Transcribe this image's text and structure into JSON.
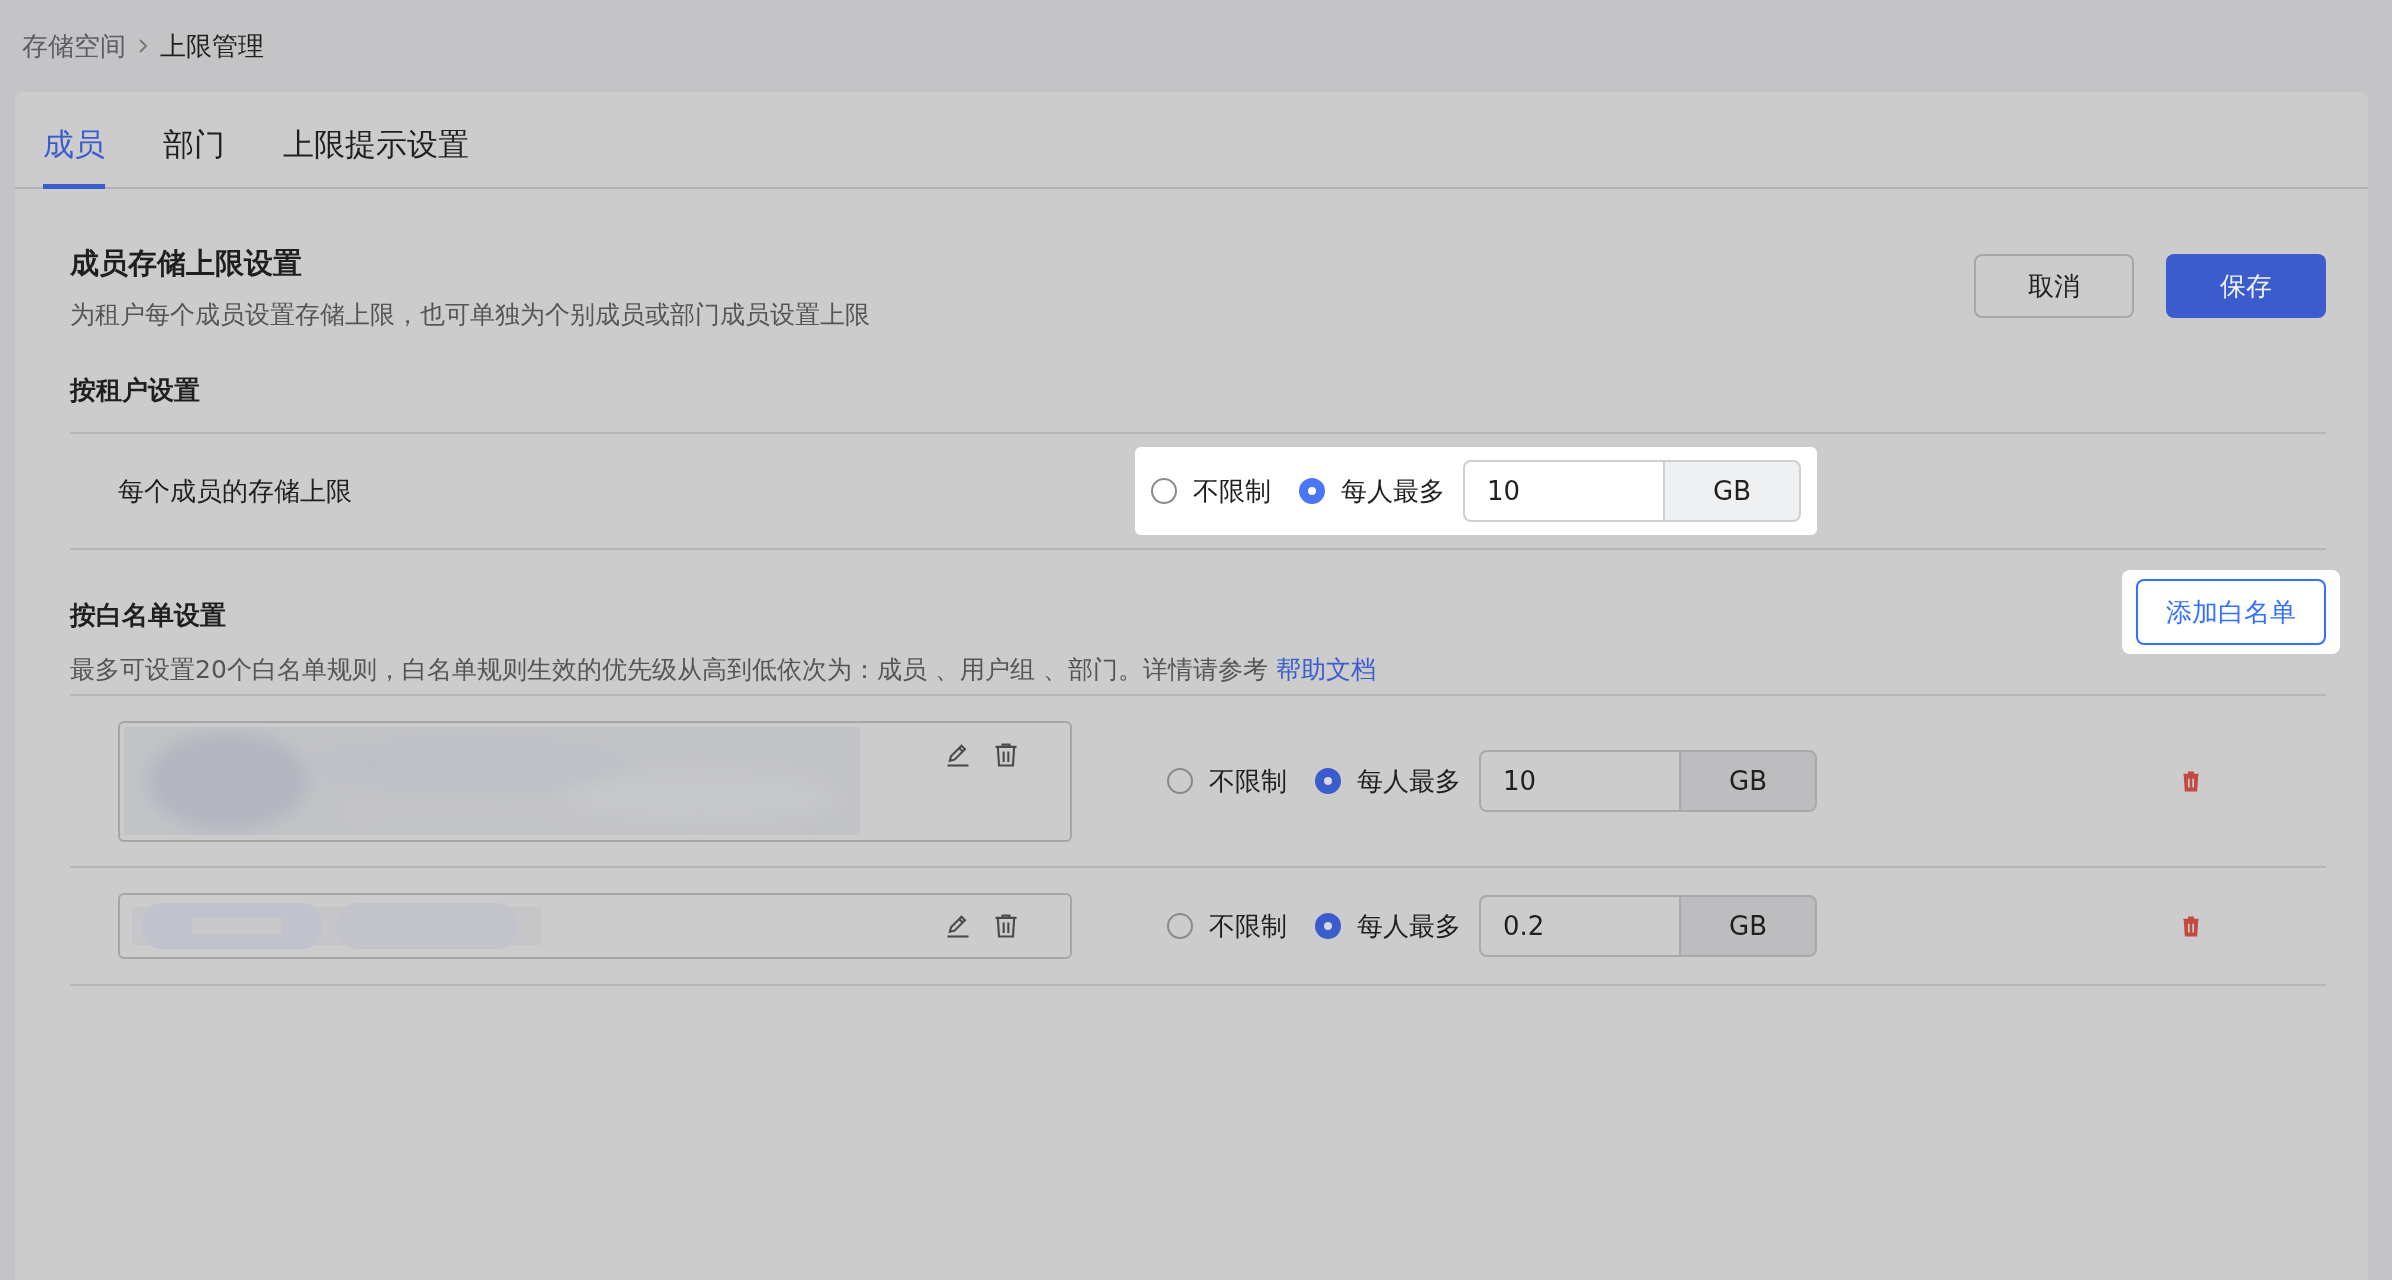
{
  "breadcrumb": [
    {
      "label": "存储空间"
    },
    {
      "label": "上限管理"
    }
  ],
  "tabs": [
    {
      "label": "成员",
      "selected": true
    },
    {
      "label": "部门",
      "selected": false
    },
    {
      "label": "上限提示设置",
      "selected": false
    }
  ],
  "header": {
    "title": "成员存储上限设置",
    "subtitle": "为租户每个成员设置存储上限，也可单独为个别成员或部门成员设置上限"
  },
  "buttons": [
    {
      "label": "取消",
      "kind": "secondary"
    },
    {
      "label": "保存",
      "kind": "primary"
    }
  ],
  "tenant_section": {
    "title": "按租户设置",
    "row": {
      "label": "每个成员的存储上限",
      "highlighted": true,
      "options": [
        {
          "label": "不限制",
          "selected": false
        },
        {
          "label": "每人最多",
          "selected": true
        }
      ],
      "value": "10",
      "unit": "GB"
    }
  },
  "whitelist_section": {
    "title": "按白名单设置",
    "description": "最多可设置20个白名单规则，白名单规则生效的优先级从高到低依次为：成员 、用户组 、部门。详情请参考",
    "help_link": "帮助文档",
    "add_button": {
      "label": "添加白名单",
      "highlighted": true
    },
    "rules": [
      {
        "kind": "block",
        "options": [
          {
            "label": "不限制",
            "selected": false
          },
          {
            "label": "每人最多",
            "selected": true
          }
        ],
        "value": "10",
        "unit": "GB"
      },
      {
        "kind": "chips",
        "options": [
          {
            "label": "不限制",
            "selected": false
          },
          {
            "label": "每人最多",
            "selected": true
          }
        ],
        "value": "0.2",
        "unit": "GB"
      }
    ]
  }
}
